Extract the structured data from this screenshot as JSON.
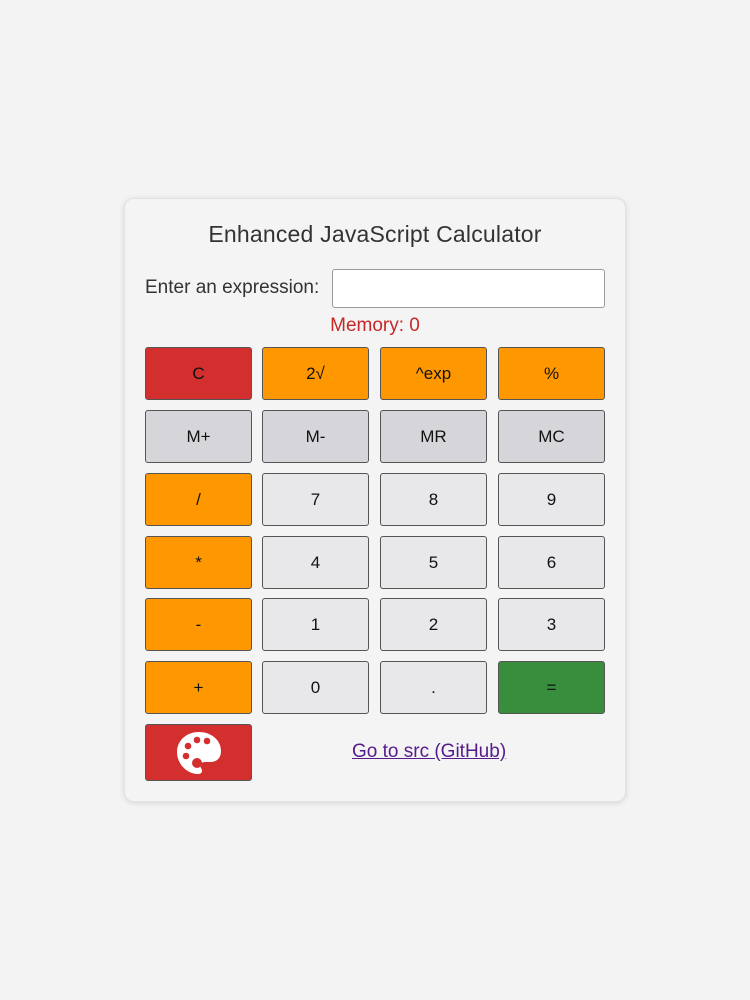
{
  "title": "Enhanced JavaScript Calculator",
  "expression": {
    "label": "Enter an expression:",
    "value": "",
    "placeholder": ""
  },
  "memory": {
    "text": "Memory: 0"
  },
  "buttons": {
    "clear": "C",
    "sqrt": "2√",
    "exp": "^exp",
    "percent": "%",
    "m_plus": "M+",
    "m_minus": "M-",
    "mr": "MR",
    "mc": "MC",
    "divide": "/",
    "seven": "7",
    "eight": "8",
    "nine": "9",
    "multiply": "*",
    "four": "4",
    "five": "5",
    "six": "6",
    "minus": "-",
    "one": "1",
    "two": "2",
    "three": "3",
    "plus": "+",
    "zero": "0",
    "decimal": ".",
    "equals": "="
  },
  "theme_button": {
    "icon": "palette-icon"
  },
  "link": {
    "text": "Go to src (GitHub)"
  },
  "colors": {
    "clear": "#d32f2f",
    "operator": "#ff9800",
    "memory": "#d6d6da",
    "digit": "#e8e8ea",
    "equals": "#388e3c",
    "memory_text": "#c62828"
  }
}
